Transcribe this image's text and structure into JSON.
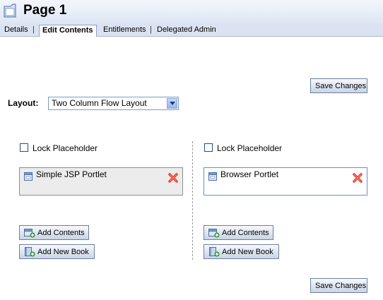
{
  "page": {
    "title": "Page 1"
  },
  "tabs": [
    {
      "label": "Details"
    },
    {
      "label": "Edit Contents"
    },
    {
      "label": "Entitlements"
    },
    {
      "label": "Delegated Admin"
    }
  ],
  "tab_separator": "|",
  "buttons": {
    "save_changes": "Save Changes",
    "add_contents": "Add Contents",
    "add_new_book": "Add New Book"
  },
  "layout": {
    "label": "Layout:",
    "selected": "Two Column Flow Layout"
  },
  "placeholders": [
    {
      "lock_label": "Lock Placeholder",
      "locked": false,
      "portlets": [
        {
          "title": "Simple JSP Portlet"
        }
      ]
    },
    {
      "lock_label": "Lock Placeholder",
      "locked": false,
      "portlets": [
        {
          "title": "Browser Portlet"
        }
      ]
    }
  ],
  "colors": {
    "header_bg": "#dde5f4",
    "accent_border": "#6d8ec2",
    "remove_red": "#e03a2e"
  },
  "icons": {
    "page": "page-icon",
    "portlet": "portlet-window-icon",
    "remove": "red-x-icon",
    "add_contents": "add-contents-icon",
    "add_book": "add-book-icon"
  }
}
